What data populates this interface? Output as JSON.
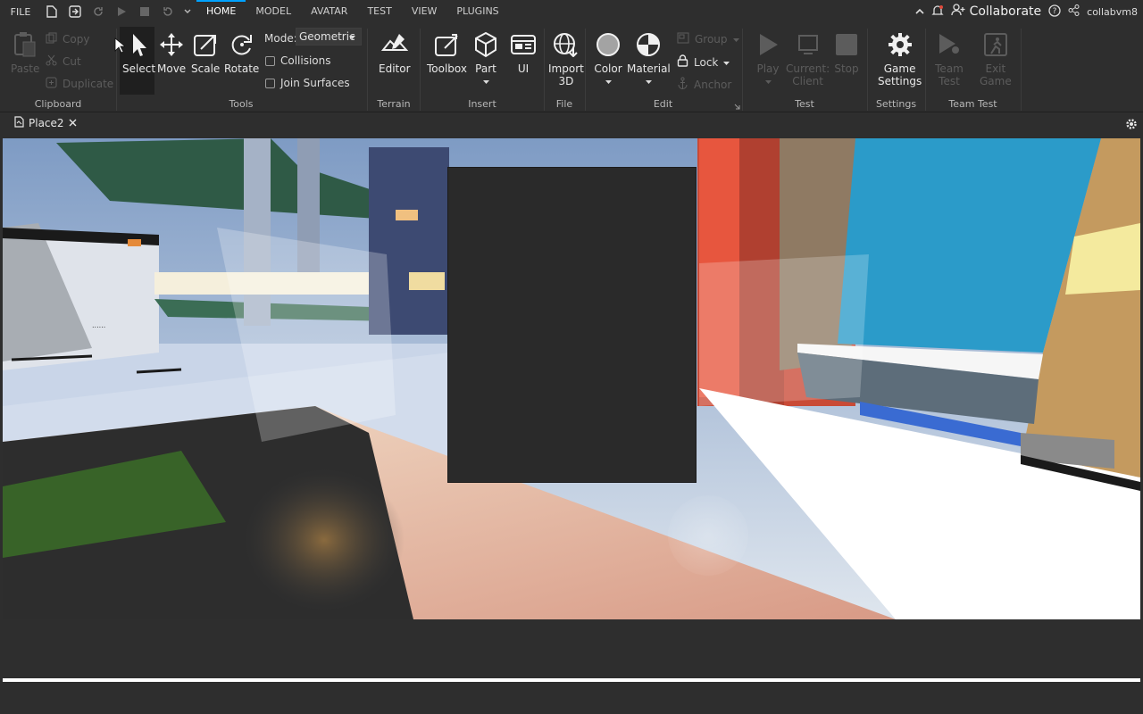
{
  "menu": {
    "file_label": "FILE"
  },
  "tabs": [
    {
      "label": "HOME",
      "active": true
    },
    {
      "label": "MODEL"
    },
    {
      "label": "AVATAR"
    },
    {
      "label": "TEST"
    },
    {
      "label": "VIEW"
    },
    {
      "label": "PLUGINS"
    }
  ],
  "topright": {
    "collaborate_label": "Collaborate",
    "username": "collabvm8"
  },
  "clipboard": {
    "paste": "Paste",
    "copy": "Copy",
    "cut": "Cut",
    "duplicate": "Duplicate",
    "group_label": "Clipboard"
  },
  "tools": {
    "select": "Select",
    "move": "Move",
    "scale": "Scale",
    "rotate": "Rotate",
    "mode_label": "Mode:",
    "mode_value": "Geometric",
    "collisions": "Collisions",
    "join_surfaces": "Join Surfaces",
    "group_label": "Tools"
  },
  "terrain": {
    "editor": "Editor",
    "group_label": "Terrain"
  },
  "insert": {
    "toolbox": "Toolbox",
    "part": "Part",
    "ui": "UI",
    "group_label": "Insert"
  },
  "file": {
    "import": "Import",
    "import_sub": "3D",
    "group_label": "File"
  },
  "edit": {
    "color": "Color",
    "material": "Material",
    "group": "Group",
    "lock": "Lock",
    "anchor": "Anchor",
    "group_label": "Edit"
  },
  "test": {
    "play": "Play",
    "current": "Current:",
    "client": "Client",
    "stop": "Stop",
    "group_label": "Test"
  },
  "settings": {
    "game": "Game",
    "settings_line": "Settings",
    "group_label": "Settings"
  },
  "teamtest": {
    "team": "Team",
    "test_line": "Test",
    "exit": "Exit",
    "game_line": "Game",
    "group_label": "Team Test"
  },
  "document": {
    "tab_label": "Place2"
  },
  "colors": {
    "accent": "#00a2ff",
    "bg": "#2e2e2e"
  }
}
